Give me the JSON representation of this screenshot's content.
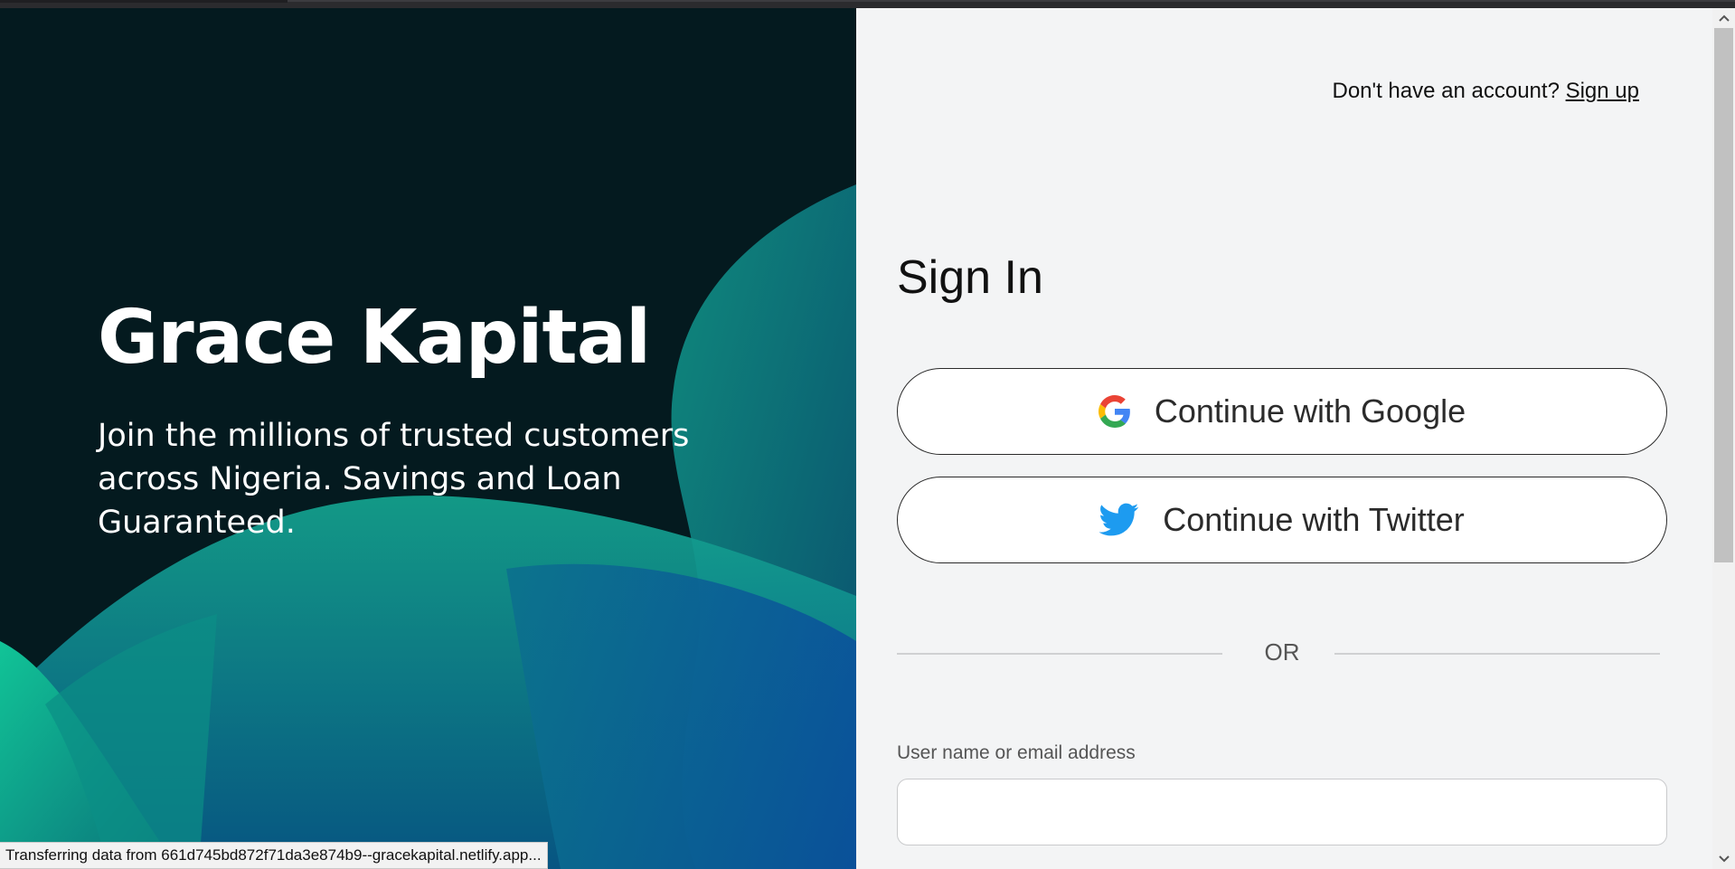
{
  "hero": {
    "title": "Grace Kapital",
    "subtitle": "Join the millions of trusted customers across Nigeria. Savings and Loan Guaranteed."
  },
  "signin": {
    "signup_prompt": "Don't have an account?",
    "signup_link": "Sign up",
    "heading": "Sign In",
    "google_button": "Continue with Google",
    "twitter_button": "Continue with Twitter",
    "divider_text": "OR",
    "username_label": "User name or email address",
    "username_value": ""
  },
  "status_bar": {
    "text": "Transferring data from 661d745bd872f71da3e874b9--gracekapital.netlify.app..."
  },
  "colors": {
    "hero_bg": "#041a1f",
    "panel_bg": "#f3f4f5",
    "twitter_blue": "#1d9bf0",
    "teal_accent": "#13b59b"
  },
  "icons": {
    "google": "google-logo-icon",
    "twitter": "twitter-bird-icon",
    "scroll_up": "chevron-up-icon",
    "scroll_down": "chevron-down-icon"
  }
}
